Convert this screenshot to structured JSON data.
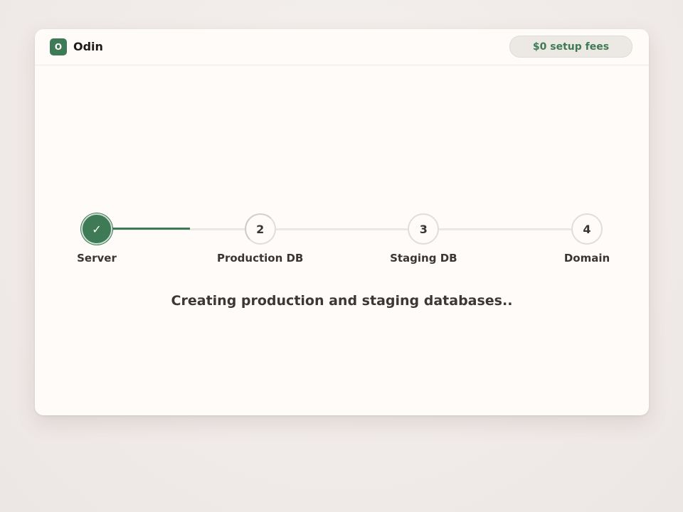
{
  "header": {
    "logo_letter": "O",
    "app_name": "Odin",
    "fees_badge": "$0 setup fees"
  },
  "stepper": {
    "progress": 0.19,
    "steps": [
      {
        "label": "Server",
        "marker": "✓",
        "state": "done"
      },
      {
        "label": "Production DB",
        "marker": "2",
        "state": "active"
      },
      {
        "label": "Staging DB",
        "marker": "3",
        "state": "pending"
      },
      {
        "label": "Domain",
        "marker": "4",
        "state": "pending"
      }
    ]
  },
  "status": {
    "message": "Creating production and staging databases.."
  },
  "colors": {
    "accent": "#3d7a55",
    "track": "#ebe7e4",
    "background": "#fffbf9"
  },
  "icons": {
    "done_step": "checkmark-icon"
  }
}
